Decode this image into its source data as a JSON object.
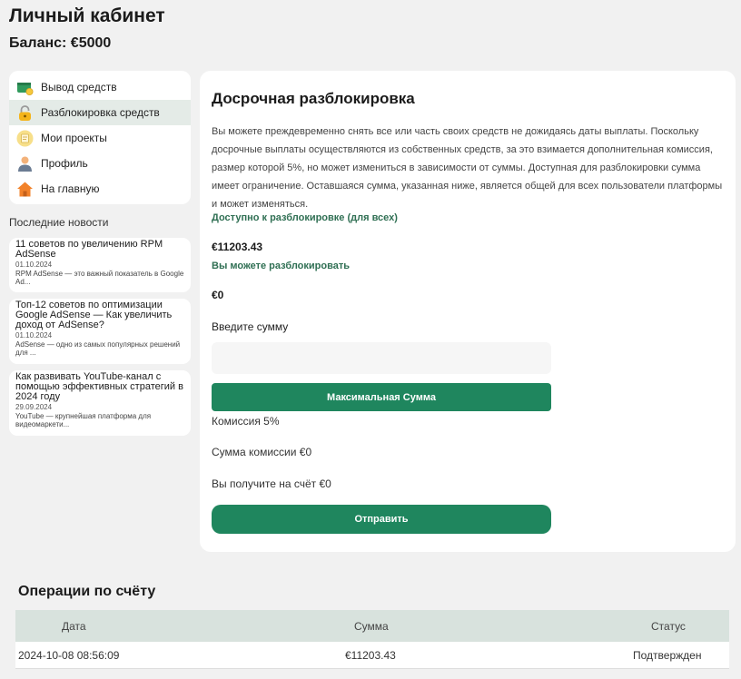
{
  "header": {
    "title": "Личный кабинет",
    "balance": "Баланс: €5000"
  },
  "sidebar": {
    "items": [
      {
        "label": "Вывод средств",
        "icon": "wallet-icon"
      },
      {
        "label": "Разблокировка средств",
        "icon": "padlock-icon",
        "active": true
      },
      {
        "label": "Мои проекты",
        "icon": "projects-icon"
      },
      {
        "label": "Профиль",
        "icon": "user-icon"
      },
      {
        "label": "На главную",
        "icon": "home-icon"
      }
    ]
  },
  "news": {
    "heading": "Последние новости",
    "items": [
      {
        "title": "11 советов по увеличению RPM AdSense",
        "date": "01.10.2024",
        "excerpt": "RPM AdSense — это важный показатель в Google Ad..."
      },
      {
        "title": "Топ-12 советов по оптимизации Google AdSense — Как увеличить доход от AdSense?",
        "date": "01.10.2024",
        "excerpt": "AdSense — одно из самых популярных решений для ..."
      },
      {
        "title": "Как развивать YouTube-канал с помощью эффективных стратегий в 2024 году",
        "date": "29.09.2024",
        "excerpt": "YouTube — крупнейшая платформа для видеомаркети..."
      }
    ]
  },
  "main": {
    "title": "Досрочная разблокировка",
    "description": "Вы можете преждевременно снять все или часть своих средств не дожидаясь даты выплаты. Поскольку досрочные выплаты осуществляются из собственных средств, за это взимается дополнительная комиссия, размер которой 5%, но может измениться в зависимости от суммы. Доступная для разблокировки сумма имеет ограничение. Оставшаяся сумма, указанная ниже, является общей для всех пользователи платформы и может изменяться.",
    "available_label": "Доступно к разблокировке (для всех)",
    "available_amount": "€11203.43",
    "can_unlock_label": "Вы можете разблокировать",
    "can_unlock_amount": "€0",
    "input_label": "Введите сумму",
    "input_value": "",
    "max_button": "Максимальная Сумма",
    "commission": "Комиссия 5%",
    "commission_sum": "Сумма комиссии €0",
    "you_receive": "Вы получите на счёт €0",
    "submit_button": "Отправить"
  },
  "operations": {
    "title": "Операции по счёту",
    "columns": [
      "Дата",
      "Сумма",
      "Статус"
    ],
    "rows": [
      {
        "date": "2024-10-08 08:56:09",
        "amount": "€11203.43",
        "status": "Подтвержден"
      }
    ]
  },
  "colors": {
    "accent": "#1f865e",
    "accent_text": "#2f6f53",
    "active_bg": "#e4ebe7",
    "table_header": "#d8e2dd"
  }
}
